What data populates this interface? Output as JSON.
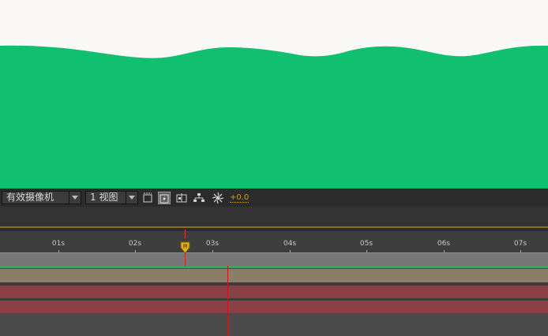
{
  "viewer": {
    "background": "#fbf8f8",
    "wave_color": "#10c06e"
  },
  "viewer_toolbar": {
    "camera_dropdown": "有效摄像机",
    "view_dropdown": "1 视图",
    "exposure": "+0.0",
    "icons": [
      "region-of-interest-icon",
      "fast-previews-icon",
      "timeline-icon",
      "flowchart-icon",
      "exposure-icon"
    ]
  },
  "timeline": {
    "ruler_labels": [
      "01s",
      "02s",
      "03s",
      "04s",
      "05s",
      "06s",
      "07s"
    ],
    "colors": {
      "work_area": "#8a6f14",
      "green_marker": "#27b446",
      "layer_tan": "#8b7e66",
      "layer_red": "#8b4044",
      "current_time_indicator": "#e2b11e"
    }
  }
}
